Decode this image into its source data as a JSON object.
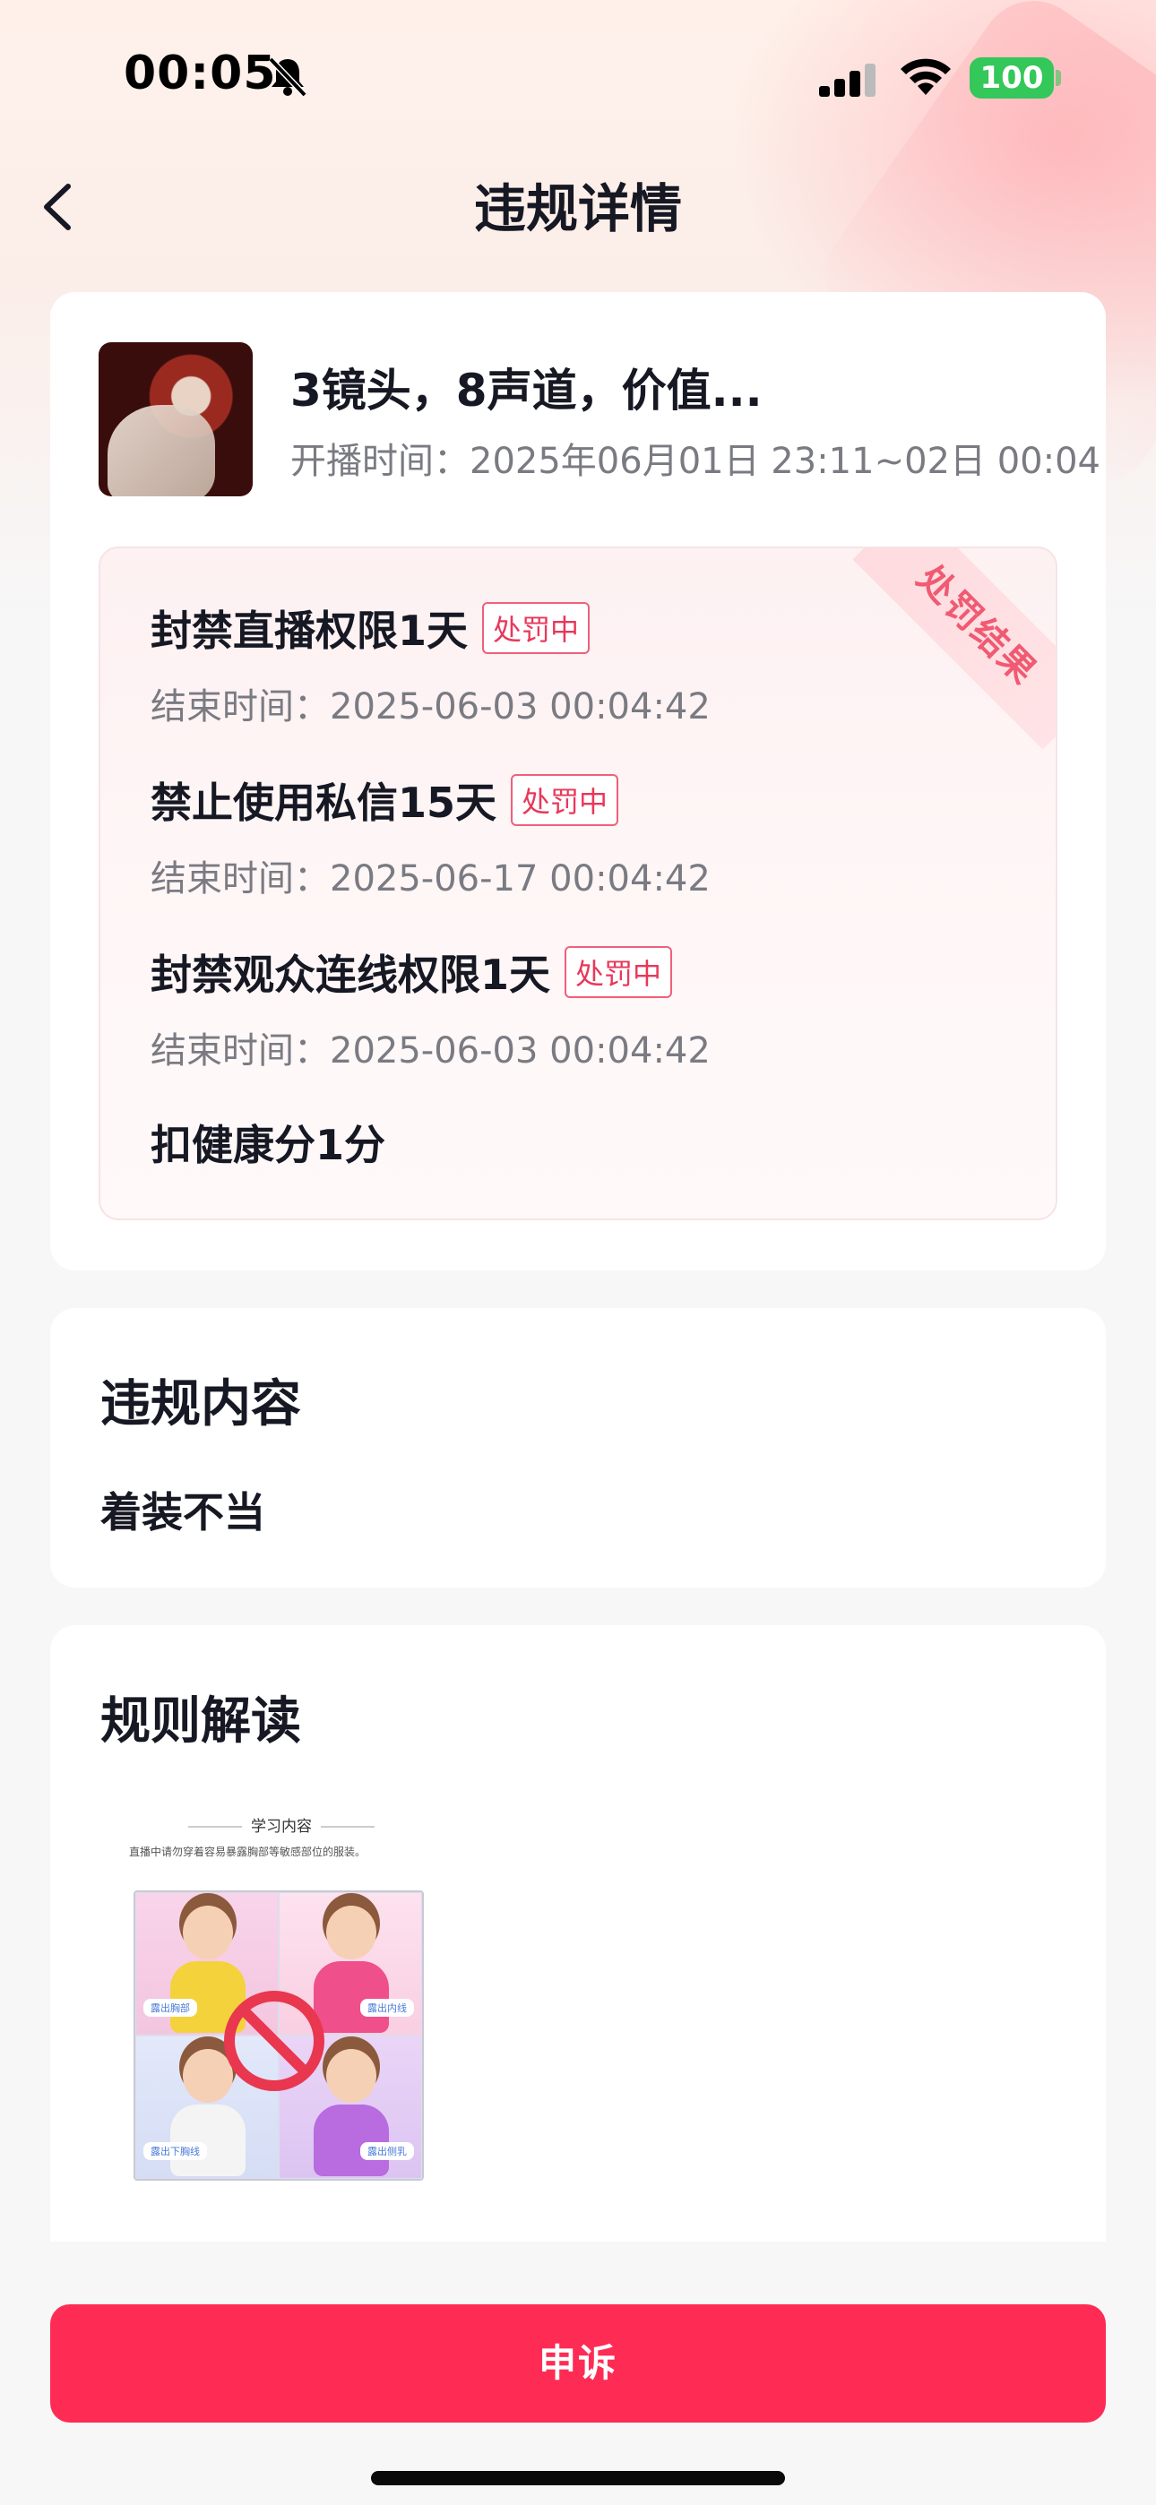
{
  "status_bar": {
    "time": "00:05",
    "battery": "100"
  },
  "nav": {
    "title": "违规详情"
  },
  "live": {
    "title": "3镜头，8声道，价值...",
    "time": "开播时间：2025年06月01日 23:11~02日 00:04"
  },
  "penalty": {
    "ribbon": "处罚结果",
    "items": [
      {
        "name": "封禁直播权限1天",
        "tag": "处罚中",
        "end": "结束时间：2025-06-03 00:04:42"
      },
      {
        "name": "禁止使用私信15天",
        "tag": "处罚中",
        "end": "结束时间：2025-06-17 00:04:42"
      },
      {
        "name": "封禁观众连线权限1天",
        "tag": "处罚中",
        "end": "结束时间：2025-06-03 00:04:42"
      }
    ],
    "deduction": "扣健康分1分"
  },
  "violation": {
    "title": "违规内容",
    "content": "着装不当"
  },
  "rules": {
    "title": "规则解读",
    "image_heading": "学习内容",
    "image_desc": "直播中请勿穿着容易暴露胸部等敏感部位的服装。",
    "tags": [
      "露出胸部",
      "露出内线",
      "露出下胸线",
      "露出侧乳"
    ]
  },
  "appeal_button": "申诉",
  "colors": {
    "accent": "#fe2c55",
    "tag": "#e8385a",
    "battery": "#34c759"
  }
}
